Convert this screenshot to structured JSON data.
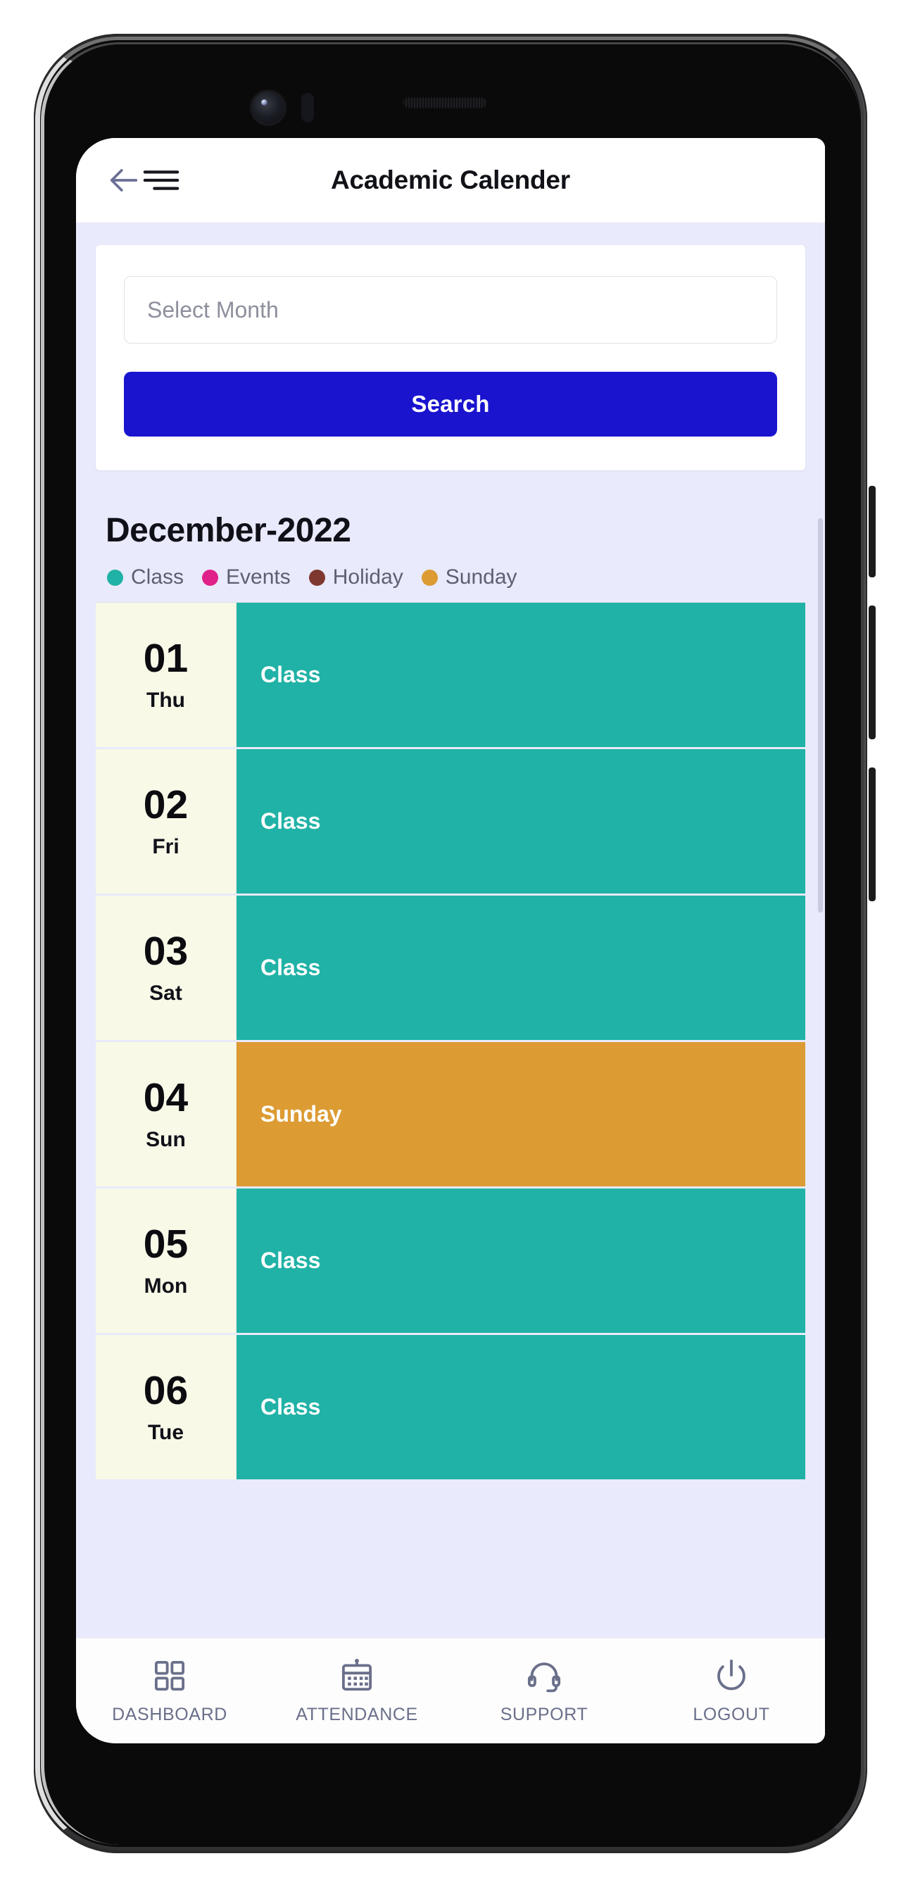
{
  "appbar": {
    "title": "Academic Calender",
    "back_icon": "arrow-left-icon",
    "menu_icon": "hamburger-menu-icon"
  },
  "search_card": {
    "month_placeholder": "Select Month",
    "month_value": "",
    "search_label": "Search"
  },
  "calendar": {
    "month_title": "December-2022",
    "legend": [
      {
        "label": "Class",
        "color": "#20b2a6"
      },
      {
        "label": "Events",
        "color": "#e0218a"
      },
      {
        "label": "Holiday",
        "color": "#7e382f"
      },
      {
        "label": "Sunday",
        "color": "#dc9b33"
      }
    ],
    "rows": [
      {
        "day": "01",
        "weekday": "Thu",
        "event": "Class",
        "color": "#20b2a6"
      },
      {
        "day": "02",
        "weekday": "Fri",
        "event": "Class",
        "color": "#20b2a6"
      },
      {
        "day": "03",
        "weekday": "Sat",
        "event": "Class",
        "color": "#20b2a6"
      },
      {
        "day": "04",
        "weekday": "Sun",
        "event": "Sunday",
        "color": "#dc9b33"
      },
      {
        "day": "05",
        "weekday": "Mon",
        "event": "Class",
        "color": "#20b2a6"
      },
      {
        "day": "06",
        "weekday": "Tue",
        "event": "Class",
        "color": "#20b2a6"
      }
    ]
  },
  "bottom_nav": [
    {
      "label": "DASHBOARD",
      "icon": "grid-squares-icon"
    },
    {
      "label": "ATTENDANCE",
      "icon": "calendar-icon"
    },
    {
      "label": "SUPPORT",
      "icon": "headset-icon"
    },
    {
      "label": "LOGOUT",
      "icon": "power-icon"
    }
  ],
  "theme": {
    "accent_blue": "#1a14cf",
    "screen_bg": "#e9eafb",
    "date_cell_bg": "#f9f9e8"
  }
}
